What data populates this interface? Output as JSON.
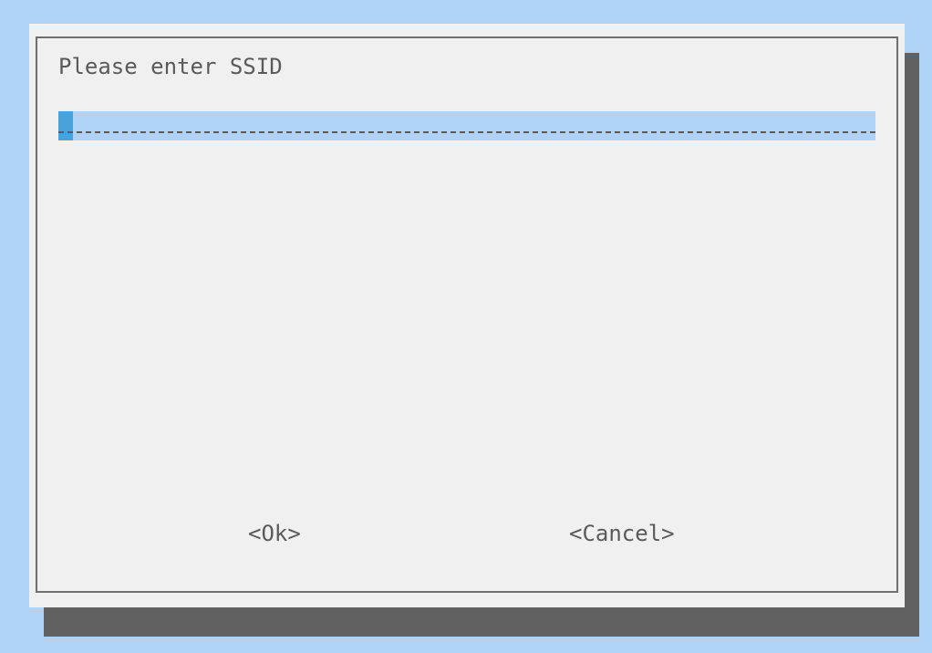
{
  "dialog": {
    "prompt": "Please enter SSID",
    "input": {
      "value": ""
    },
    "buttons": {
      "ok_label": "<Ok>",
      "cancel_label": "<Cancel>"
    }
  },
  "colors": {
    "background": "#aed3f7",
    "dialog_background": "#f0f0f0",
    "shadow": "#616161",
    "input_background": "#aed3f7",
    "cursor": "#4aa3d8",
    "text": "#5a5a5a"
  }
}
